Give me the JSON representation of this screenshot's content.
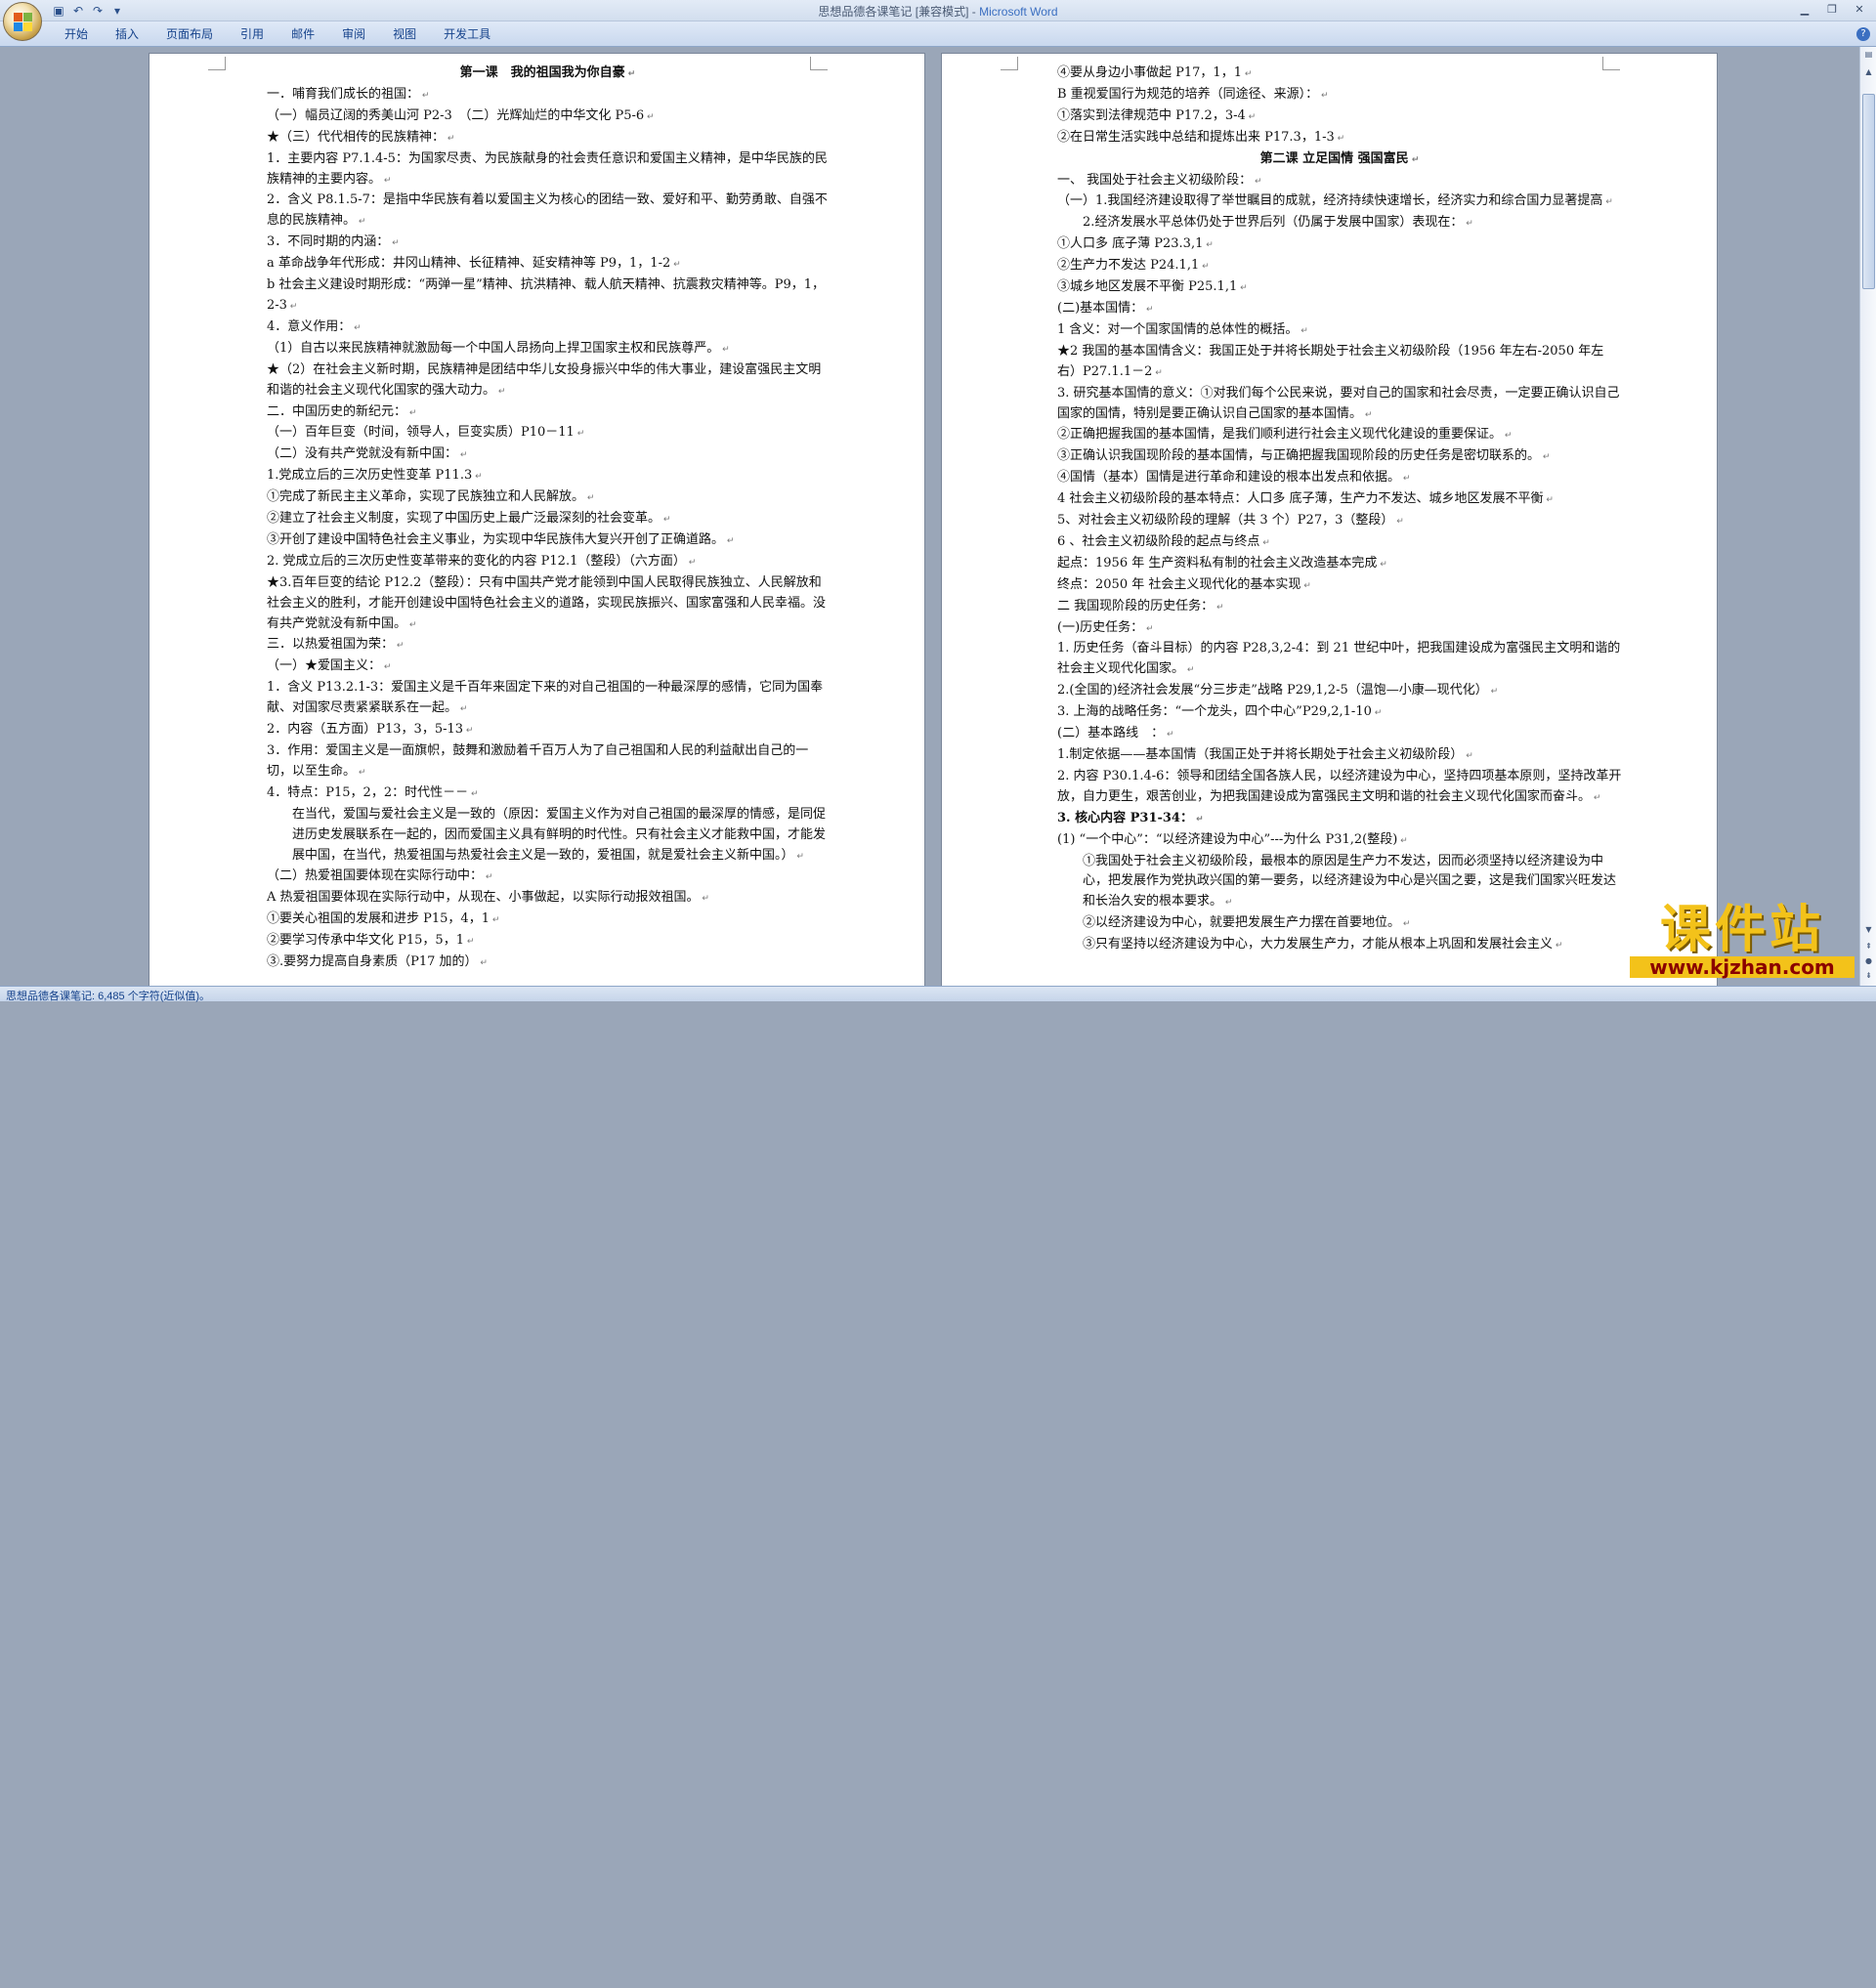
{
  "window": {
    "title": "思想品德各课笔记 [兼容模式]",
    "app_name": "Microsoft Word",
    "separator": " - "
  },
  "qat": {
    "save_icon": "save-icon",
    "undo_icon": "undo-icon",
    "redo_icon": "redo-icon"
  },
  "ribbon": {
    "tabs": [
      "开始",
      "插入",
      "页面布局",
      "引用",
      "邮件",
      "审阅",
      "视图",
      "开发工具"
    ]
  },
  "page1": {
    "lines": [
      {
        "t": "第一课　我的祖国我为你自豪",
        "s": "b c"
      },
      {
        "t": "一．哺育我们成长的祖国：",
        "s": ""
      },
      {
        "t": "（一）幅员辽阔的秀美山河 P2-3　（二）光辉灿烂的中华文化 P5-6",
        "s": ""
      },
      {
        "t": "★（三）代代相传的民族精神：",
        "s": ""
      },
      {
        "t": "1．主要内容 P7.1.4-5：为国家尽责、为民族献身的社会责任意识和爱国主义精神，是中华民族的民族精神的主要内容。",
        "s": ""
      },
      {
        "t": "2．含义 P8.1.5-7：是指中华民族有着以爱国主义为核心的团结一致、爱好和平、勤劳勇敢、自强不息的民族精神。",
        "s": ""
      },
      {
        "t": "3．不同时期的内涵：",
        "s": ""
      },
      {
        "t": "a 革命战争年代形成：井冈山精神、长征精神、延安精神等 P9，1，1-2",
        "s": ""
      },
      {
        "t": "b 社会主义建设时期形成：“两弹一星”精神、抗洪精神、载人航天精神、抗震救灾精神等。P9，1，2-3",
        "s": ""
      },
      {
        "t": "4．意义作用：",
        "s": ""
      },
      {
        "t": "（1）自古以来民族精神就激励每一个中国人昂扬向上捍卫国家主权和民族尊严。",
        "s": ""
      },
      {
        "t": "★（2）在社会主义新时期，民族精神是团结中华儿女投身振兴中华的伟大事业，建设富强民主文明和谐的社会主义现代化国家的强大动力。",
        "s": ""
      },
      {
        "t": "二．中国历史的新纪元：",
        "s": ""
      },
      {
        "t": "（一）百年巨变（时间，领导人，巨变实质）P10－11",
        "s": ""
      },
      {
        "t": "（二）没有共产党就没有新中国：",
        "s": ""
      },
      {
        "t": "1.党成立后的三次历史性变革 P11.3",
        "s": ""
      },
      {
        "t": "①完成了新民主主义革命，实现了民族独立和人民解放。",
        "s": ""
      },
      {
        "t": "②建立了社会主义制度，实现了中国历史上最广泛最深刻的社会变革。",
        "s": ""
      },
      {
        "t": "③开创了建设中国特色社会主义事业，为实现中华民族伟大复兴开创了正确道路。",
        "s": ""
      },
      {
        "t": "2. 党成立后的三次历史性变革带来的变化的内容 P12.1（整段）（六方面）",
        "s": ""
      },
      {
        "t": "★3.百年巨变的结论 P12.2（整段）：只有中国共产党才能领到中国人民取得民族独立、人民解放和社会主义的胜利，才能开创建设中国特色社会主义的道路，实现民族振兴、国家富强和人民幸福。没有共产党就没有新中国。",
        "s": ""
      },
      {
        "t": "三．以热爱祖国为荣：",
        "s": ""
      },
      {
        "t": "（一）★爱国主义：",
        "s": ""
      },
      {
        "t": "1．含义 P13.2.1-3：爱国主义是千百年来固定下来的对自己祖国的一种最深厚的感情，它同为国奉献、对国家尽责紧紧联系在一起。",
        "s": ""
      },
      {
        "t": "2．内容（五方面）P13，3，5-13",
        "s": ""
      },
      {
        "t": "3．作用：爱国主义是一面旗帜，鼓舞和激励着千百万人为了自己祖国和人民的利益献出自己的一切，以至生命。",
        "s": ""
      },
      {
        "t": "4．特点：P15，2，2：时代性－－",
        "s": ""
      },
      {
        "t": "在当代，爱国与爱社会主义是一致的（原因：爱国主义作为对自己祖国的最深厚的情感，是同促进历史发展联系在一起的，因而爱国主义具有鲜明的时代性。只有社会主义才能救中国，才能发展中国，在当代，热爱祖国与热爱社会主义是一致的，爱祖国，就是爱社会主义新中国。）",
        "s": "ind"
      },
      {
        "t": "（二）热爱祖国要体现在实际行动中：",
        "s": ""
      },
      {
        "t": "A 热爱祖国要体现在实际行动中，从现在、小事做起，以实际行动报效祖国。",
        "s": ""
      },
      {
        "t": "①要关心祖国的发展和进步 P15，4，1",
        "s": ""
      },
      {
        "t": "②要学习传承中华文化 P15，5，1",
        "s": ""
      },
      {
        "t": "③.要努力提高自身素质（P17 加的）",
        "s": ""
      }
    ]
  },
  "page2": {
    "lines": [
      {
        "t": "④要从身边小事做起 P17，1，1",
        "s": ""
      },
      {
        "t": "B 重视爱国行为规范的培养（同途径、来源）：",
        "s": ""
      },
      {
        "t": "①落实到法律规范中 P17.2，3-4",
        "s": ""
      },
      {
        "t": "②在日常生活实践中总结和提炼出来 P17.3，1-3",
        "s": ""
      },
      {
        "t": "第二课  立足国情  强国富民",
        "s": "b c"
      },
      {
        "t": "一、 我国处于社会主义初级阶段：",
        "s": ""
      },
      {
        "t": "（一）1.我国经济建设取得了举世瞩目的成就，经济持续快速增长，经济实力和综合国力显著提高",
        "s": ""
      },
      {
        "t": "2.经济发展水平总体仍处于世界后列（仍属于发展中国家）表现在：",
        "s": "ind"
      },
      {
        "t": "①人口多  底子薄 P23.3,1",
        "s": ""
      },
      {
        "t": "②生产力不发达 P24.1,1",
        "s": ""
      },
      {
        "t": "③城乡地区发展不平衡 P25.1,1",
        "s": ""
      },
      {
        "t": "(二)基本国情：",
        "s": ""
      },
      {
        "t": "1 含义：对一个国家国情的总体性的概括。",
        "s": ""
      },
      {
        "t": "★2 我国的基本国情含义：我国正处于并将长期处于社会主义初级阶段（1956 年左右-2050 年左右）P27.1.1－2",
        "s": ""
      },
      {
        "t": "3. 研究基本国情的意义：①对我们每个公民来说，要对自己的国家和社会尽责，一定要正确认识自己国家的国情，特别是要正确认识自己国家的基本国情。",
        "s": ""
      },
      {
        "t": "②正确把握我国的基本国情，是我们顺利进行社会主义现代化建设的重要保证。",
        "s": ""
      },
      {
        "t": "③正确认识我国现阶段的基本国情，与正确把握我国现阶段的历史任务是密切联系的。",
        "s": ""
      },
      {
        "t": "④国情（基本）国情是进行革命和建设的根本出发点和依据。",
        "s": ""
      },
      {
        "t": "4 社会主义初级阶段的基本特点：人口多 底子薄，生产力不发达、城乡地区发展不平衡",
        "s": ""
      },
      {
        "t": "5、对社会主义初级阶段的理解（共 3 个）P27，3（整段）",
        "s": ""
      },
      {
        "t": "6 、社会主义初级阶段的起点与终点",
        "s": ""
      },
      {
        "t": "起点：1956 年 生产资料私有制的社会主义改造基本完成",
        "s": ""
      },
      {
        "t": "终点：2050 年 社会主义现代化的基本实现",
        "s": ""
      },
      {
        "t": "二 我国现阶段的历史任务：",
        "s": ""
      },
      {
        "t": "(一)历史任务：",
        "s": ""
      },
      {
        "t": "1. 历史任务（奋斗目标）的内容 P28,3,2-4：到 21 世纪中叶，把我国建设成为富强民主文明和谐的社会主义现代化国家。",
        "s": ""
      },
      {
        "t": "2.(全国的)经济社会发展“分三步走”战略 P29,1,2-5（温饱—小康—现代化）",
        "s": ""
      },
      {
        "t": "3. 上海的战略任务：“一个龙头，四个中心”P29,2,1-10",
        "s": ""
      },
      {
        "t": "(二）基本路线　：",
        "s": ""
      },
      {
        "t": "1.制定依据——基本国情（我国正处于并将长期处于社会主义初级阶段）",
        "s": ""
      },
      {
        "t": "2. 内容 P30.1.4-6：领导和团结全国各族人民，以经济建设为中心，坚持四项基本原则，坚持改革开放，自力更生，艰苦创业，为把我国建设成为富强民主文明和谐的社会主义现代化国家而奋斗。",
        "s": ""
      },
      {
        "t": "3. 核心内容 P31-34：",
        "s": "b"
      },
      {
        "t": "(1) “一个中心”：“以经济建设为中心”---为什么 P31,2(整段)",
        "s": ""
      },
      {
        "t": "①我国处于社会主义初级阶段，最根本的原因是生产力不发达，因而必须坚持以经济建设为中心，把发展作为党执政兴国的第一要务，以经济建设为中心是兴国之要，这是我们国家兴旺发达和长治久安的根本要求。",
        "s": "ind"
      },
      {
        "t": "②以经济建设为中心，就要把发展生产力摆在首要地位。",
        "s": "ind"
      },
      {
        "t": "③只有坚持以经济建设为中心，大力发展生产力，才能从根本上巩固和发展社会主义",
        "s": "ind"
      }
    ]
  },
  "status": {
    "text": "思想品德各课笔记: 6,485 个字符(近似值)。"
  },
  "watermark": {
    "big": "课件站",
    "url": "www.kjzhan.com"
  }
}
